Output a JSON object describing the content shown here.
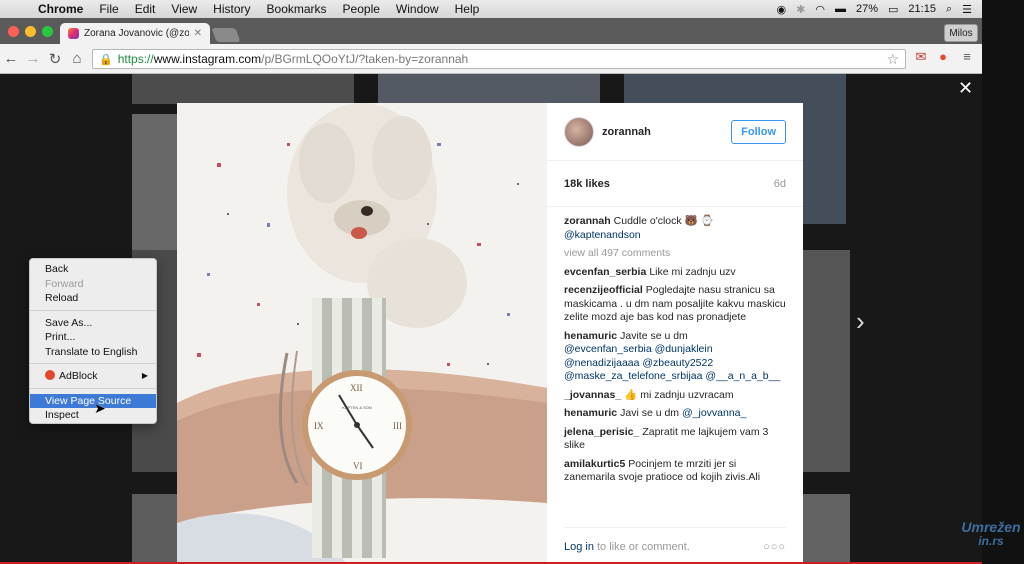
{
  "menubar": {
    "app": "Chrome",
    "items": [
      "File",
      "Edit",
      "View",
      "History",
      "Bookmarks",
      "People",
      "Window",
      "Help"
    ],
    "battery": "27%",
    "time": "21:15"
  },
  "browser": {
    "tab_title": "Zorana Jovanovic (@zoran",
    "profile": "Milos",
    "url_scheme": "https://",
    "url_host": "www.instagram.com",
    "url_path": "/p/BGrmLQOoYtJ/?taken-by=zorannah"
  },
  "post": {
    "username": "zorannah",
    "follow_label": "Follow",
    "likes": "18k likes",
    "age": "6d",
    "caption_user": "zorannah",
    "caption_text": "Cuddle o'clock 🐻",
    "caption_mention": "@kaptenandson",
    "view_all": "view all 497 comments",
    "comments": [
      {
        "user": "evcenfan_serbia",
        "text": "Like mi zadnju uzv"
      },
      {
        "user": "recenzijeofficial",
        "text": "Pogledajte nasu stranicu sa maskicama . u dm nam posaljite kakvu maskicu zelite mozd aje bas kod nas pronadjete"
      },
      {
        "user": "henamuric",
        "text": "Javite se u dm",
        "mentions": "@evcenfan_serbia @dunjaklein @nenadizijaaaa @zbeauty2522 @maske_za_telefone_srbijaa @__a_n_a_b__"
      },
      {
        "user": "_jovannas_",
        "text": "👍 mi zadnju uzvracam"
      },
      {
        "user": "henamuric",
        "text": "Javi se u dm",
        "mentions": "@_jovvanna_"
      },
      {
        "user": "jelena_perisic_",
        "text": "Zapratit me lajkujem vam 3 slike"
      },
      {
        "user": "amilakurtic5",
        "text": "Pocinjem te mrziti jer si zanemarila svoje pratioce od kojih zivis.Ali"
      }
    ],
    "login_label": "Log in",
    "login_rest": "to like or comment.",
    "more_dots": "○○○",
    "watch_brand": "KAPTEN & SON"
  },
  "context_menu": {
    "back": "Back",
    "forward": "Forward",
    "reload": "Reload",
    "save_as": "Save As...",
    "print": "Print...",
    "translate": "Translate to English",
    "adblock": "AdBlock",
    "view_source": "View Page Source",
    "inspect": "Inspect"
  },
  "watermark": {
    "line1": "Umrežen",
    "line2": "in.rs"
  },
  "colors": {
    "accent": "#3897f0",
    "link": "#003569",
    "menu_highlight": "#3d79d6"
  }
}
